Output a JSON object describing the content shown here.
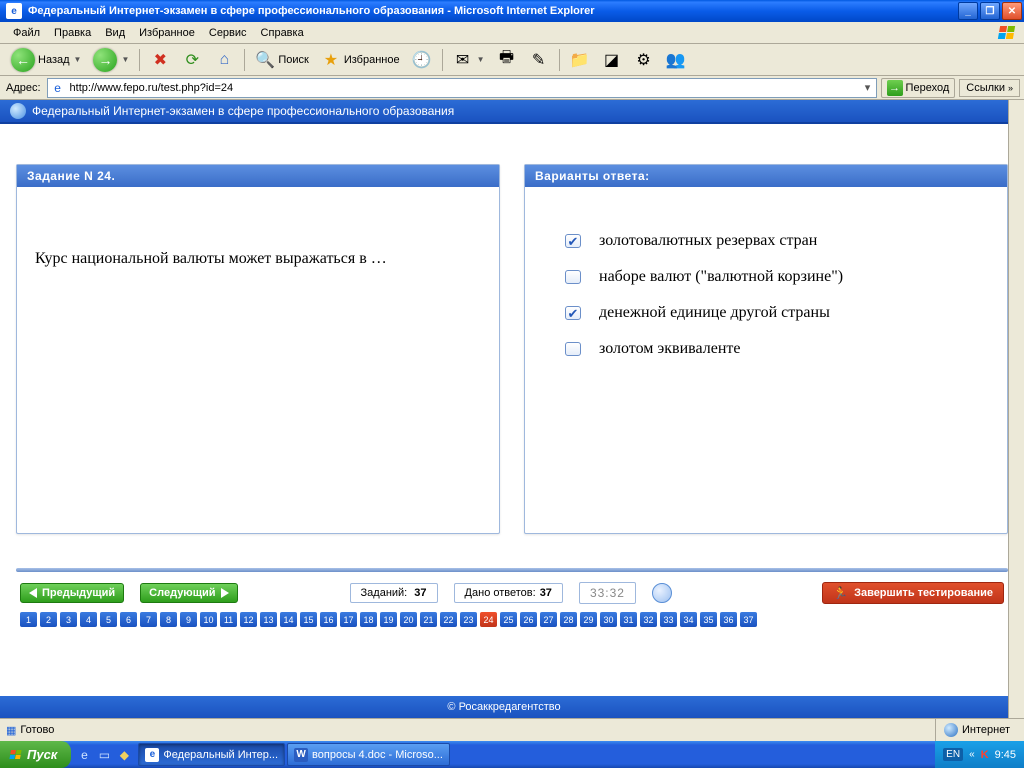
{
  "window": {
    "title": "Федеральный Интернет-экзамен в сфере профессионального образования - Microsoft Internet Explorer"
  },
  "menubar": {
    "items": [
      "Файл",
      "Правка",
      "Вид",
      "Избранное",
      "Сервис",
      "Справка"
    ]
  },
  "toolbar": {
    "back_label": "Назад",
    "search_label": "Поиск",
    "favorites_label": "Избранное"
  },
  "addressbar": {
    "label": "Адрес:",
    "url": "http://www.fepo.ru/test.php?id=24",
    "go_label": "Переход",
    "links_label": "Ссылки"
  },
  "page": {
    "header": "Федеральный Интернет-экзамен в сфере профессионального образования",
    "task_panel_title": "Задание N 24.",
    "task_text": "Курс национальной валюты может выражаться в …",
    "answers_panel_title": "Варианты ответа:",
    "answers": [
      {
        "text": "золотовалютных резервах стран",
        "checked": true
      },
      {
        "text": "наборе валют (\"валютной корзине\")",
        "checked": false
      },
      {
        "text": "денежной единице другой страны",
        "checked": true
      },
      {
        "text": "золотом эквиваленте",
        "checked": false
      }
    ],
    "prev_label": "Предыдущий",
    "next_label": "Следующий",
    "tasks_label": "Заданий:",
    "tasks_count": "37",
    "answered_label": "Дано ответов:",
    "answered_count": "37",
    "timer": "33:32",
    "finish_label": "Завершить тестирование",
    "total_questions": 37,
    "current_question": 24,
    "footer": "© Росаккредагентство"
  },
  "statusbar": {
    "status": "Готово",
    "zone": "Интернет"
  },
  "taskbar": {
    "start": "Пуск",
    "items": [
      {
        "label": "Федеральный Интер...",
        "icon": "ie",
        "active": true
      },
      {
        "label": "вопросы 4.doc - Microso...",
        "icon": "word",
        "active": false
      }
    ],
    "lang": "EN",
    "time": "9:45"
  }
}
